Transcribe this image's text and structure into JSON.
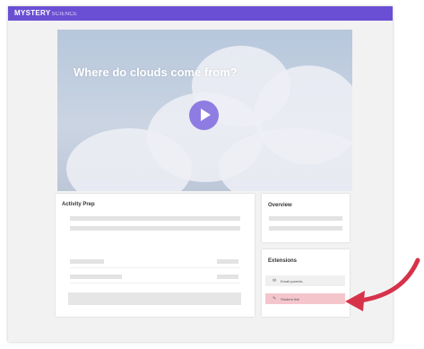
{
  "brand": {
    "name_bold": "MYSTERY",
    "name_light": "SCIENCE"
  },
  "video": {
    "title": "Where do clouds come from?",
    "play_icon": "play-icon"
  },
  "activity_prep": {
    "title": "Activity Prep"
  },
  "overview": {
    "title": "Overview"
  },
  "extensions": {
    "title": "Extensions",
    "items": [
      {
        "label": "Email parents",
        "icon": "mail-icon"
      },
      {
        "label": "Student link",
        "icon": "link-icon"
      }
    ]
  },
  "colors": {
    "brand_purple": "#6a4fd4",
    "highlight_pink": "#f4c6cc",
    "arrow_red": "#d6334a"
  }
}
